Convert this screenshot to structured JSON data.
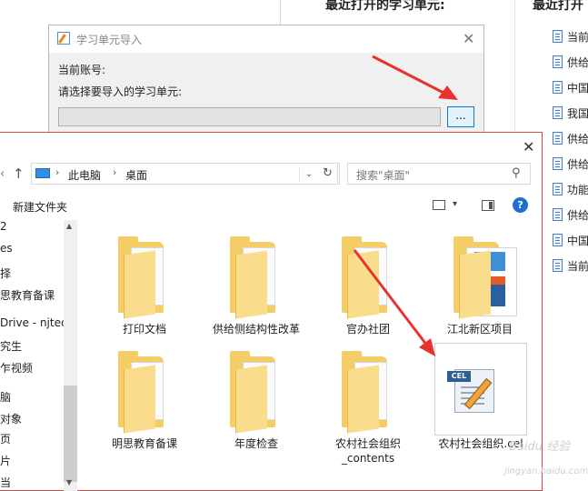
{
  "background": {
    "heading_recent_units": "最近打开的学习单元:",
    "heading_recent_right": "最近打开",
    "doc_items": [
      "当前",
      "供给",
      "中国",
      "我国",
      "供给",
      "供给",
      "功能",
      "供给",
      "中国",
      "当前"
    ]
  },
  "import_dialog": {
    "title": "学习单元导入",
    "account_label": "当前账号:",
    "select_label": "请选择要导入的学习单元:",
    "browse_label": "...",
    "close_glyph": "✕"
  },
  "file_dialog": {
    "close_glyph": "✕",
    "back_glyph": "‹",
    "up_glyph": "↑",
    "breadcrumb": [
      "此电脑",
      "桌面"
    ],
    "breadcrumb_sep": "›",
    "dropdown_glyph": "⌄",
    "refresh_glyph": "↻",
    "search_placeholder": "搜索\"桌面\"",
    "search_glyph": "⚲",
    "new_folder": "新建文件夹",
    "view_dd_glyph": "▾",
    "help_glyph": "?",
    "nav_items": [
      "2",
      "es",
      "择",
      "思教育备课",
      "Drive - njtec",
      "究生",
      "乍视频",
      "脑",
      "对象",
      "页",
      "片",
      "当"
    ],
    "scroll_up": "▲",
    "scroll_down": "▼",
    "files": [
      {
        "name": "打印文档",
        "kind": "folder-lines"
      },
      {
        "name": "供给侧结构性改革",
        "kind": "folder-image"
      },
      {
        "name": "官办社团",
        "kind": "folder"
      },
      {
        "name": "江北新区项目",
        "kind": "folder-book"
      },
      {
        "name": "明思教育备课",
        "kind": "folder-lines"
      },
      {
        "name": "年度检查",
        "kind": "folder"
      },
      {
        "name": "农村社会组织_contents",
        "kind": "folder-image"
      },
      {
        "name": "农村社会组织.cel",
        "kind": "cel-file"
      }
    ],
    "cel_badge": "CEL"
  },
  "watermark": {
    "line1": "Baidu 经验",
    "line2": "jingyan.baidu.com"
  },
  "colors": {
    "accent": "#0078d7",
    "arrow": "#e8322d",
    "folder": "#f5cd66"
  }
}
